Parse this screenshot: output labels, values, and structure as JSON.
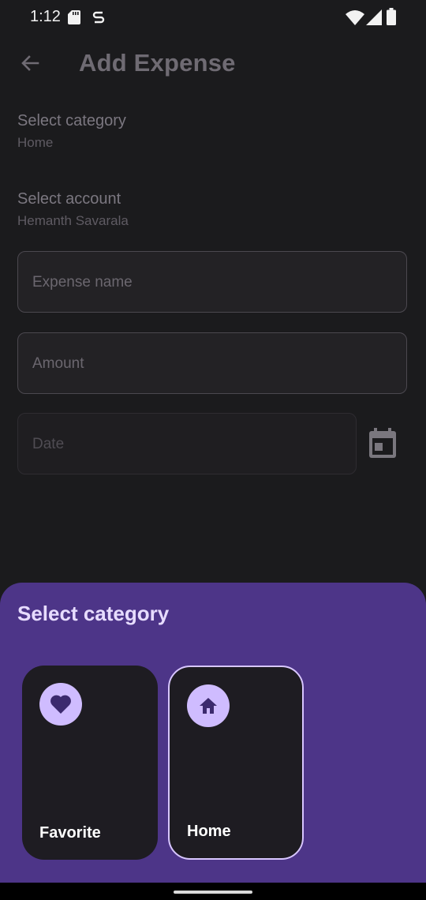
{
  "status_bar": {
    "time": "1:12",
    "icons": [
      "sd-card-icon",
      "sync-icon",
      "wifi-icon",
      "signal-icon",
      "battery-icon"
    ]
  },
  "app_bar": {
    "title": "Add Expense",
    "back_icon": "arrow-back-icon"
  },
  "form": {
    "category": {
      "label": "Select category",
      "value": "Home"
    },
    "account": {
      "label": "Select account",
      "value": "Hemanth Savarala"
    },
    "expense_name": {
      "placeholder": "Expense name",
      "value": ""
    },
    "amount": {
      "placeholder": "Amount",
      "value": ""
    },
    "date": {
      "placeholder": "Date",
      "value": "",
      "icon": "calendar-icon"
    }
  },
  "bottom_sheet": {
    "title": "Select category",
    "categories": [
      {
        "label": "Favorite",
        "icon": "heart-icon",
        "selected": false
      },
      {
        "label": "Home",
        "icon": "home-icon",
        "selected": true
      }
    ]
  },
  "colors": {
    "background": "#1b1b1d",
    "sheet": "#4d3588",
    "accent": "#cfbcff",
    "card": "#1e1c22"
  }
}
